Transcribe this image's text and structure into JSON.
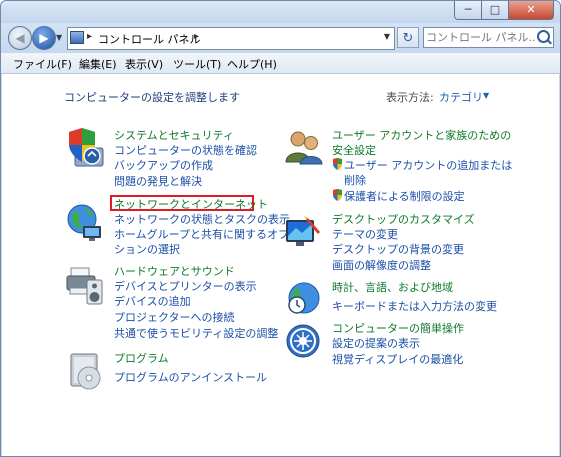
{
  "window": {
    "buttons": {
      "minimize": "─",
      "maximize": "□",
      "close": "✕"
    }
  },
  "nav": {
    "breadcrumb": "コントロール パネル",
    "search_placeholder": "コントロール パネル...",
    "refresh_icon": "refresh-icon"
  },
  "menu": [
    "ファイル(F)",
    "編集(E)",
    "表示(V)",
    "ツール(T)",
    "ヘルプ(H)"
  ],
  "main": {
    "heading": "コンピューターの設定を調整します",
    "view_label": "表示方法:",
    "view_value": "カテゴリ"
  },
  "left_categories": [
    {
      "title": "システムとセキュリティ",
      "links": [
        "コンピューターの状態を確認",
        "バックアップの作成",
        "問題の発見と解決"
      ]
    },
    {
      "title": "ネットワークとインターネット",
      "links": [
        "ネットワークの状態とタスクの表示",
        "ホームグループと共有に関するオプ",
        "ションの選択"
      ]
    },
    {
      "title": "ハードウェアとサウンド",
      "links": [
        "デバイスとプリンターの表示",
        "デバイスの追加",
        "プロジェクターへの接続",
        "共通で使うモビリティ設定の調整"
      ]
    },
    {
      "title": "プログラム",
      "links": [
        "プログラムのアンインストール"
      ]
    }
  ],
  "right_categories": [
    {
      "title": "ユーザー アカウントと家族のための",
      "title2": "安全設定",
      "links": [
        "ユーザー アカウントの追加または",
        "削除",
        "保護者による制限の設定"
      ]
    },
    {
      "title": "デスクトップのカスタマイズ",
      "links": [
        "テーマの変更",
        "デスクトップの背景の変更",
        "画面の解像度の調整"
      ]
    },
    {
      "title": "時計、言語、および地域",
      "links": [
        "キーボードまたは入力方法の変更"
      ]
    },
    {
      "title": "コンピューターの簡単操作",
      "links": [
        "設定の提案の表示",
        "視覚ディスプレイの最適化"
      ]
    }
  ],
  "colors": {
    "category": "#0d7a2b",
    "link": "#1b4fa8",
    "highlight": "#e01b24"
  }
}
